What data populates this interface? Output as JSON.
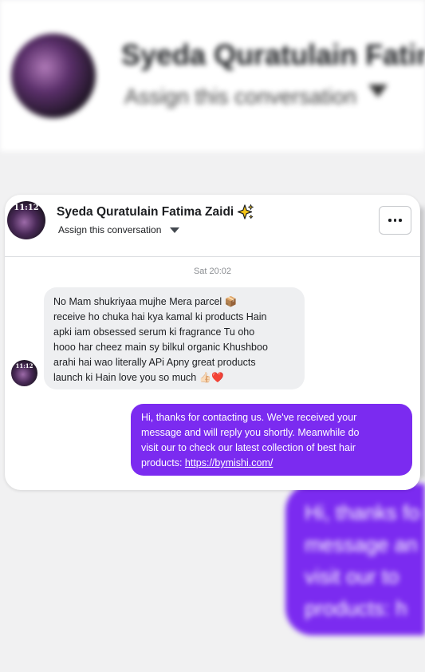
{
  "background": {
    "contact_name": "Syeda Quratulain Fatima Zaidi",
    "assign_label": "Assign this conversation",
    "bubble_lines": [
      "Hi, thanks fo",
      "message an",
      "visit our to",
      "products: h"
    ]
  },
  "header": {
    "contact_name": "Syeda Quratulain Fatima Zaidi",
    "name_emoji_icon": "sparkles-icon",
    "assign_label": "Assign this conversation",
    "avatar_time": "11:12",
    "more_icon": "more-options-icon"
  },
  "conversation": {
    "timestamp": "Sat 20:02",
    "incoming": {
      "avatar_time": "11:12",
      "lines": [
        "No Mam shukriyaa mujhe Mera parcel 📦",
        "receive ho chuka hai kya kamal ki products Hain",
        "apki iam obsessed serum ki fragrance Tu oho",
        "hooo har cheez main sy bilkul organic Khushboo",
        "arahi hai wao literally APi Apny great products",
        "launch ki Hain love you so much 👍🏻❤️"
      ]
    },
    "outgoing": {
      "lines": [
        "Hi, thanks for contacting us. We've received your",
        "message and will reply you shortly. Meanwhile do",
        "visit our to check our latest collection of best hair"
      ],
      "last_line_prefix": "products: ",
      "link_text": "https://bymishi.com/"
    }
  },
  "colors": {
    "outgoing_bubble": "#7b2bf0",
    "incoming_bubble": "#eeeff1",
    "timestamp_text": "#8a8d91"
  }
}
